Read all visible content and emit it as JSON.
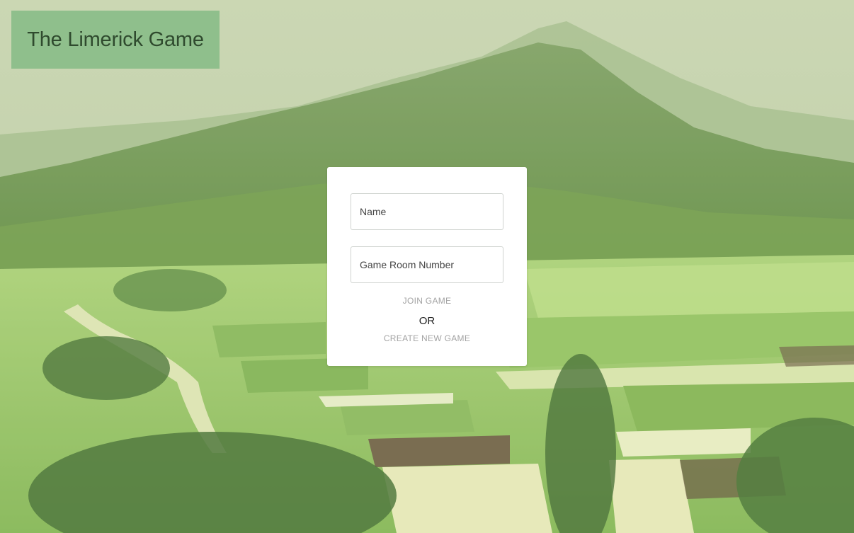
{
  "header": {
    "title": "The Limerick Game"
  },
  "form": {
    "name_placeholder": "Name",
    "room_placeholder": "Game Room Number",
    "join_label": "JOIN GAME",
    "or_label": "OR",
    "create_label": "CREATE NEW GAME"
  },
  "colors": {
    "title_bg": "#8fbf8c",
    "title_text": "#2f4a2e",
    "card_bg": "#ffffff",
    "muted_action": "#a3a3a3"
  }
}
